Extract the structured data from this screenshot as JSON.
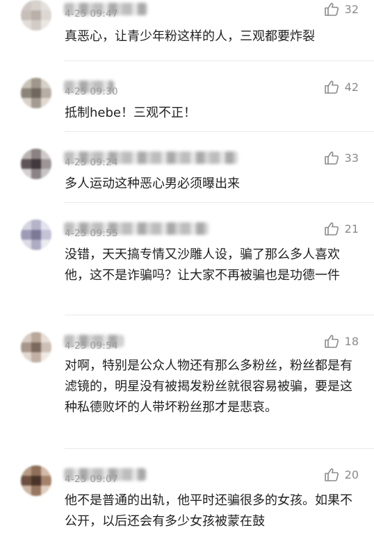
{
  "comments": [
    {
      "time": "4-25 09:47",
      "text": "真恶心，让青少年粉这样的人，三观都要炸裂",
      "likes": "32",
      "avatar": [
        "#cfc8c4",
        "#d8d2cd",
        "#e5e0dc",
        "#c7beb8",
        "#b9b0aa",
        "#ddd7d2",
        "#e2ddd8",
        "#d2cbc6",
        "#ebe7e3"
      ],
      "name_width": 120
    },
    {
      "time": "4-25 09:30",
      "text": "抵制hebe！三观不正！",
      "likes": "42",
      "avatar": [
        "#c9c2b8",
        "#9f978b",
        "#d6d0c6",
        "#8c8478",
        "#6f685e",
        "#b7afa4",
        "#d8d2ca",
        "#a49c92",
        "#e0dad3"
      ],
      "name_width": 72
    },
    {
      "time": "4-25 09:24",
      "text": "多人运动这种恶心男必须曝出来",
      "likes": "33",
      "avatar": [
        "#b9b4b2",
        "#8a8281",
        "#cfcac9",
        "#5f5559",
        "#3f393d",
        "#9e9597",
        "#d4cfd0",
        "#8b8385",
        "#c8c3c4"
      ],
      "name_width": 250
    },
    {
      "time": "4-25 09:55",
      "text": "没错，天天搞专情又沙雕人设，骗了那么多人喜欢他，这不是诈骗吗？让大家不再被骗也是功德一件",
      "likes": "21",
      "avatar": [
        "#d4d4e2",
        "#b4b3c8",
        "#e3e2ee",
        "#9e9bb8",
        "#7c7896",
        "#c4c2d6",
        "#dcdbe7",
        "#aeacc4",
        "#ebeaf2"
      ],
      "name_width": 208
    },
    {
      "time": "4-25 09:54",
      "text": "对啊，特别是公众人物还有那么多粉丝，粉丝都是有滤镜的，明星没有被揭发粉丝就很容易被骗，要是这种私德败坏的人带坏粉丝那才是悲哀。",
      "likes": "18",
      "avatar": [
        "#d8ccc3",
        "#b9a89a",
        "#e6ddd6",
        "#a8968a",
        "#7b695e",
        "#cdbfb4",
        "#e2d8d0",
        "#c1b0a3",
        "#efe9e4"
      ],
      "name_width": 86
    },
    {
      "time": "4-25 09:07",
      "text": "他不是普通的出轨，他平时还骗很多的女孩。如果不公开，以后还会有多少女孩被蒙在鼓",
      "likes": "20",
      "avatar": [
        "#b79a84",
        "#8f6f5a",
        "#d2bba8",
        "#6e5040",
        "#4a342a",
        "#a4826b",
        "#cdb6a3",
        "#97775f",
        "#e0cfc1"
      ],
      "name_width": 118
    }
  ]
}
